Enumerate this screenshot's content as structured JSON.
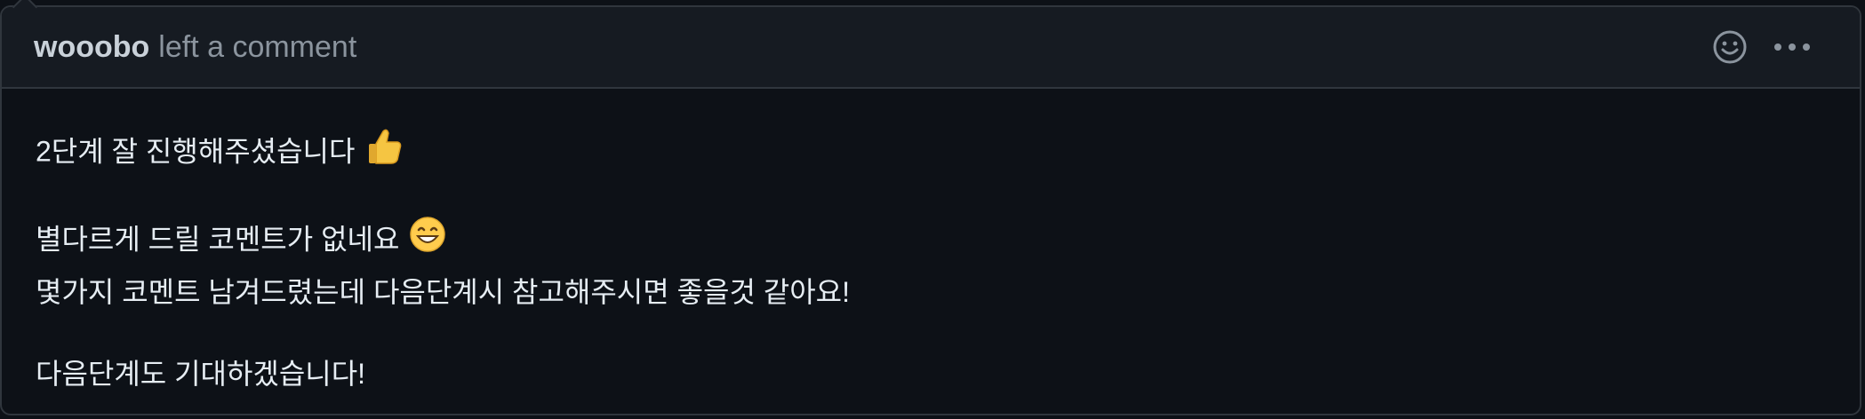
{
  "comment": {
    "author": "wooobo",
    "action": "left a comment",
    "header_icons": [
      "smiley-icon",
      "kebab-menu-icon"
    ],
    "paragraphs": [
      [
        "2단계 잘 진행해주셨습니다"
      ],
      [
        "별다르게 드릴 코멘트가 없네요",
        "몇가지 코멘트 남겨드렸는데 다음단계시 참고해주시면 좋을것 같아요!"
      ],
      [
        "다음단계도 기대하겠습니다!"
      ]
    ]
  },
  "colors": {
    "background": "#0d1117",
    "header_bg": "#161b22",
    "border": "#30363d",
    "muted_text": "#8b949e",
    "text": "#e6edf3"
  }
}
